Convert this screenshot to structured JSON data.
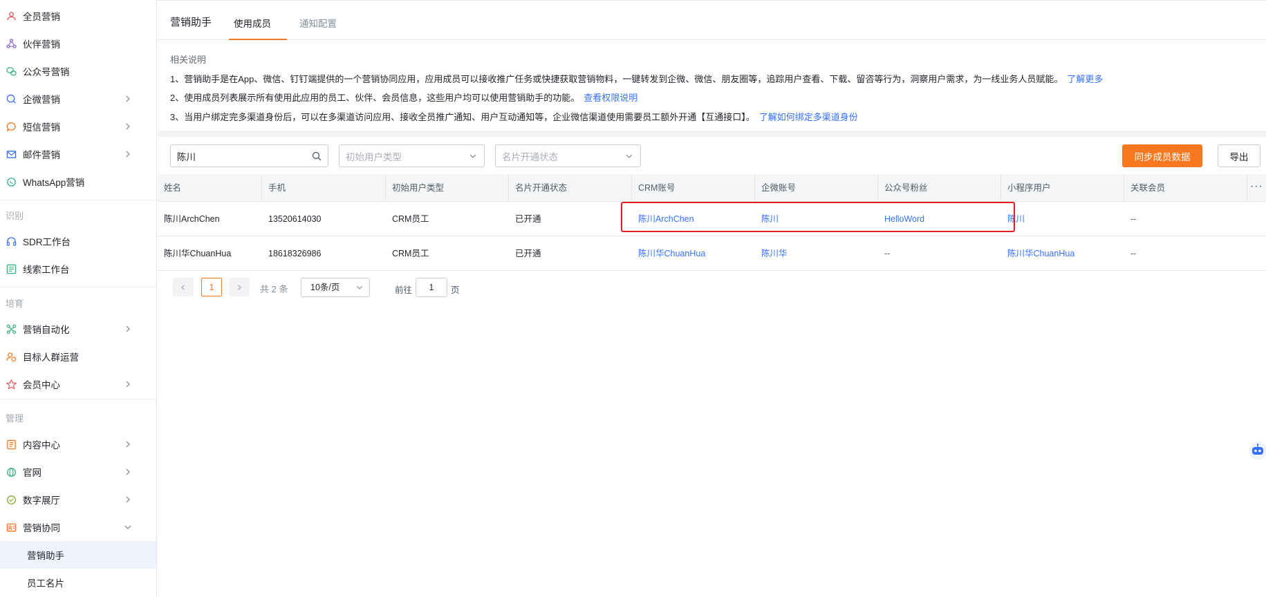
{
  "sidebar": {
    "items_top": [
      {
        "label": "全员营销",
        "icon": "team-icon",
        "color": "#e8595a"
      },
      {
        "label": "伙伴营销",
        "icon": "share-icon",
        "color": "#8a63d2"
      },
      {
        "label": "公众号营销",
        "icon": "wechat-icon",
        "color": "#36b37e"
      },
      {
        "label": "企微营销",
        "icon": "chat-icon",
        "color": "#3370ff"
      },
      {
        "label": "短信营销",
        "icon": "message-icon",
        "color": "#f7781f"
      },
      {
        "label": "邮件营销",
        "icon": "mail-icon",
        "color": "#3370ff"
      },
      {
        "label": "WhatsApp营销",
        "icon": "whatsapp-icon",
        "color": "#36b37e"
      }
    ],
    "section_identify": "识别",
    "items_identify": [
      {
        "label": "SDR工作台",
        "icon": "headset-icon",
        "color": "#3370ff"
      },
      {
        "label": "线索工作台",
        "icon": "list-icon",
        "color": "#36b37e"
      }
    ],
    "section_nurture": "培育",
    "items_nurture": [
      {
        "label": "营销自动化",
        "icon": "flow-icon",
        "color": "#36b37e"
      },
      {
        "label": "目标人群运营",
        "icon": "target-user-icon",
        "color": "#f7781f"
      },
      {
        "label": "会员中心",
        "icon": "member-icon",
        "color": "#e8595a"
      }
    ],
    "section_manage": "管理",
    "items_manage": [
      {
        "label": "内容中心",
        "icon": "document-icon",
        "color": "#f7781f"
      },
      {
        "label": "官网",
        "icon": "globe-icon",
        "color": "#36b37e"
      },
      {
        "label": "数字展厅",
        "icon": "exhibition-icon",
        "color": "#86b030"
      },
      {
        "label": "营销协同",
        "icon": "collab-icon",
        "color": "#f7781f"
      }
    ],
    "sub_items": [
      "营销助手",
      "员工名片"
    ]
  },
  "header": {
    "title": "营销助手",
    "tabs": [
      "使用成员",
      "通知配置"
    ]
  },
  "description": {
    "title": "相关说明",
    "line1": "1、营销助手是在App、微信、钉钉端提供的一个营销协同应用，应用成员可以接收推广任务或快捷获取营销物料，一键转发到企微、微信、朋友圈等，追踪用户查看、下载、留咨等行为，洞察用户需求，为一线业务人员赋能。",
    "link1": "了解更多",
    "line2": "2、使用成员列表展示所有使用此应用的员工、伙伴、会员信息，这些用户均可以使用营销助手的功能。",
    "link2": "查看权限说明",
    "line3": "3、当用户绑定完多渠道身份后，可以在多渠道访问应用、接收全员推广通知、用户互动通知等，企业微信渠道使用需要员工额外开通【互通接口】。",
    "link3": "了解如何绑定多渠道身份"
  },
  "filters": {
    "search_value": "陈川",
    "user_type_placeholder": "初始用户类型",
    "card_status_placeholder": "名片开通状态",
    "sync_button": "同步成员数据",
    "export_button": "导出"
  },
  "table": {
    "columns": [
      "姓名",
      "手机",
      "初始用户类型",
      "名片开通状态",
      "CRM账号",
      "企微账号",
      "公众号粉丝",
      "小程序用户",
      "关联会员"
    ],
    "more": "···",
    "rows": [
      [
        "陈川ArchChen",
        "13520614030",
        "CRM员工",
        "已开通",
        "陈川ArchChen",
        "陈川",
        "HelloWord",
        "陈川",
        "--"
      ],
      [
        "陈川华ChuanHua",
        "18618326986",
        "CRM员工",
        "已开通",
        "陈川华ChuanHua",
        "陈川华",
        "--",
        "陈川华ChuanHua",
        "--"
      ]
    ]
  },
  "pagination": {
    "current": "1",
    "total": "共 2 条",
    "page_size": "10条/页",
    "goto_label": "前往",
    "goto_value": "1",
    "page_label": "页"
  },
  "colors": {
    "accent": "#f7781f",
    "link": "#3370ff",
    "highlight": "#e02020"
  }
}
